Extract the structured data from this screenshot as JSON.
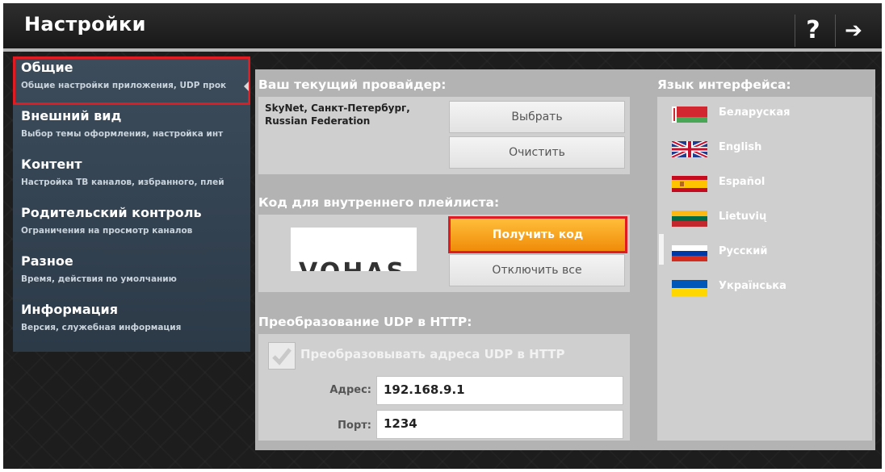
{
  "header": {
    "title": "Настройки",
    "help_icon": "?",
    "exit_icon": "➔"
  },
  "sidebar": {
    "items": [
      {
        "title": "Общие",
        "subtitle": "Общие настройки приложения, UDP прок"
      },
      {
        "title": "Внешний вид",
        "subtitle": "Выбор темы оформления, настройка инт"
      },
      {
        "title": "Контент",
        "subtitle": "Настройка ТВ каналов, избранного, плей"
      },
      {
        "title": "Родительский контроль",
        "subtitle": "Ограничения на просмотр каналов"
      },
      {
        "title": "Разное",
        "subtitle": "Время, действия по умолчанию"
      },
      {
        "title": "Информация",
        "subtitle": "Версия, служебная информация"
      }
    ]
  },
  "provider": {
    "title": "Ваш текущий провайдер:",
    "name": "SkyNet, Санкт-Петербург, Russian Federation",
    "select_button": "Выбрать",
    "clear_button": "Очистить"
  },
  "playlist": {
    "title": "Код для внутреннего плейлиста:",
    "code_fragment": "VOHAS",
    "get_code_button": "Получить код",
    "disable_all_button": "Отключить все"
  },
  "udp": {
    "title": "Преобразование UDP в HTTP:",
    "checkbox_label": "Преобразовывать адреса UDP в HTTP",
    "address_label": "Адрес:",
    "address_value": "192.168.9.1",
    "port_label": "Порт:",
    "port_value": "1234"
  },
  "language": {
    "title": "Язык интерфейса:",
    "items": [
      {
        "name": "Беларуская",
        "flag": "belarus-flag"
      },
      {
        "name": "English",
        "flag": "uk-flag"
      },
      {
        "name": "Español",
        "flag": "spain-flag"
      },
      {
        "name": "Lietuvių",
        "flag": "lithuania-flag"
      },
      {
        "name": "Русский",
        "flag": "russia-flag"
      },
      {
        "name": "Українська",
        "flag": "ukraine-flag"
      }
    ]
  },
  "colors": {
    "accent_orange": "#f5a01e",
    "highlight_red": "#e11b22",
    "sidebar_blue": "#34434f"
  }
}
